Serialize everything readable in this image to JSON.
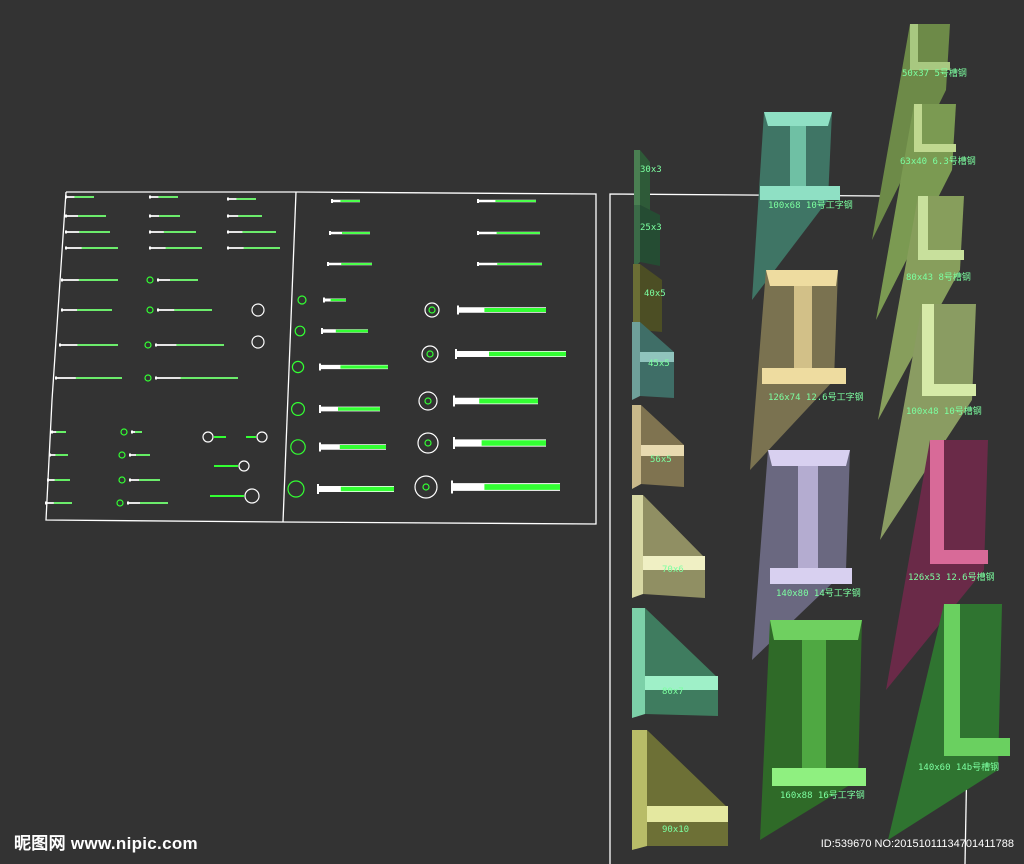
{
  "watermark": {
    "site": "昵图网 www.nipic.com",
    "id": "ID:539670 NO:20151011134701411788"
  },
  "angle_steel": [
    "30x3",
    "25x3",
    "40x5",
    "45x5",
    "56x5",
    "70x6",
    "80x7",
    "90x10"
  ],
  "i_beams": [
    "100x68 10号工字钢",
    "126x74 12.6号工字钢",
    "140x80 14号工字钢",
    "160x88 16号工字钢"
  ],
  "channels": [
    "50x37 5号槽钢",
    "63x40 6.3号槽钢",
    "80x43 8号槽钢",
    "100x48 10号槽钢",
    "126x53 12.6号槽钢",
    "140x60 14b号槽钢"
  ],
  "colors": {
    "background": "#333333",
    "line": "#ffffff",
    "accent": "#33ff33",
    "label": "#7CFFA0"
  }
}
